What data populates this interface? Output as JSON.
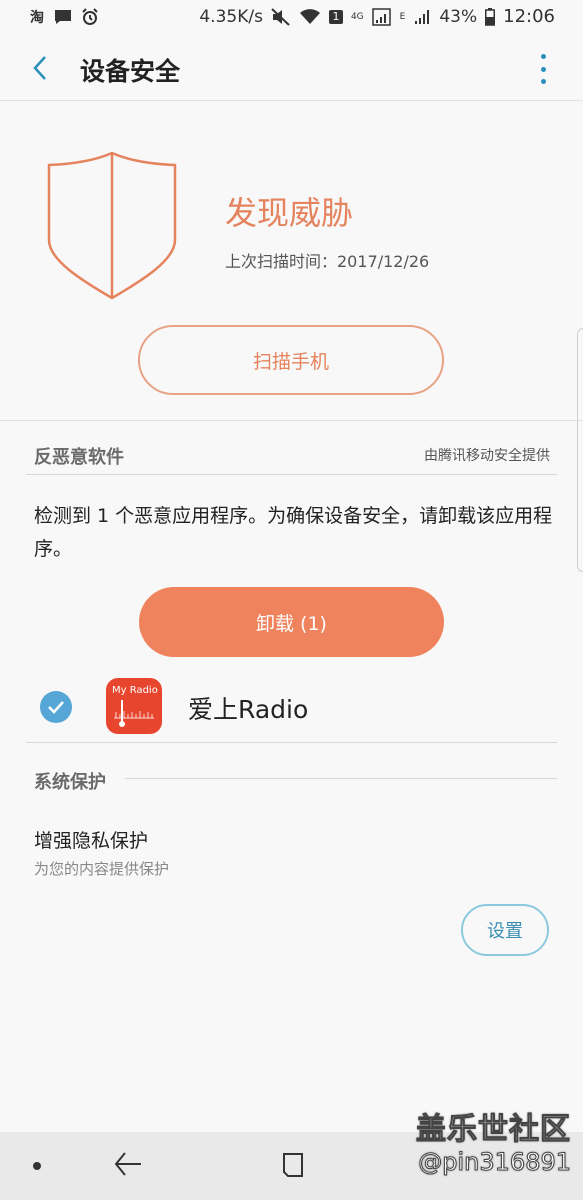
{
  "status_bar": {
    "left_icons": [
      "taobao-icon",
      "message-icon",
      "alarm-icon"
    ],
    "taobao_label": "淘",
    "speed": "4.35K/s",
    "sim1_badge": "1",
    "network_4g": "4G",
    "network_e": "E",
    "battery": "43%",
    "time": "12:06"
  },
  "app_bar": {
    "title": "设备安全"
  },
  "threat": {
    "title": "发现威胁",
    "last_scan": "上次扫描时间：2017/12/26",
    "scan_button": "扫描手机",
    "shield_color": "#e4835d"
  },
  "antimalware": {
    "section_title": "反恶意软件",
    "provider": "由腾讯移动安全提供",
    "message": "检测到 1 个恶意应用程序。为确保设备安全，请卸载该应用程序。",
    "uninstall_button": "卸载 (1)",
    "app": {
      "icon_text": "My Radio",
      "name": "爱上Radio",
      "checked": true
    }
  },
  "system_protection": {
    "section_title": "系统保护",
    "item_title": "增强隐私保护",
    "item_subtitle": "为您的内容提供保护",
    "settings_button": "设置"
  },
  "watermark": {
    "title": "盖乐世社区",
    "user": "@pin316891"
  },
  "colors": {
    "accent": "#e4835d",
    "uninstall_bg": "#ef835d",
    "link_blue": "#3c8fb3",
    "check_blue": "#56a7d8"
  }
}
